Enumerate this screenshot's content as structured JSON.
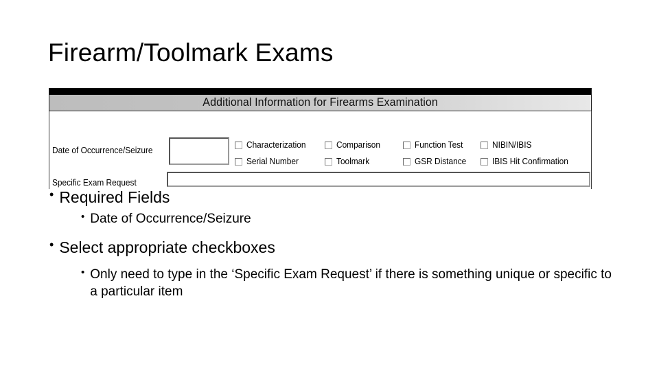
{
  "slide": {
    "title": "Firearm/Toolmark Exams"
  },
  "form": {
    "header_title": "Additional Information for Firearms Examination",
    "fields": [
      {
        "label": "Date of Occurrence/Seizure",
        "value": "",
        "placeholder": ""
      },
      {
        "label": "Specific Exam Request",
        "value": "",
        "placeholder": ""
      }
    ],
    "checkbox_rows": [
      [
        {
          "label": "Characterization",
          "checked": false
        },
        {
          "label": "Comparison",
          "checked": false
        },
        {
          "label": "Function Test",
          "checked": false
        },
        {
          "label": "NIBIN/IBIS",
          "checked": false
        }
      ],
      [
        {
          "label": "Serial Number",
          "checked": false
        },
        {
          "label": "Toolmark",
          "checked": false
        },
        {
          "label": "GSR Distance",
          "checked": false
        },
        {
          "label": "IBIS Hit Confirmation",
          "checked": false
        }
      ]
    ]
  },
  "bullets": [
    {
      "level": 1,
      "marker": "•",
      "text": "Required Fields"
    },
    {
      "level": 2,
      "marker": "•",
      "text": "Date of Occurrence/Seizure"
    },
    {
      "level": 1,
      "marker": "•",
      "text": "Select appropriate checkboxes"
    },
    {
      "level": 2,
      "marker": "•",
      "text": "Only need to type in the ‘Specific Exam Request’ if there is something unique or specific to a particular item"
    }
  ],
  "colors": {
    "background": "#ffffff",
    "text": "#000000",
    "header_bar": "#000000",
    "header_gradient_left": "#bdbdbd",
    "header_gradient_right": "#e8e8e8",
    "input_border": "#555555"
  }
}
